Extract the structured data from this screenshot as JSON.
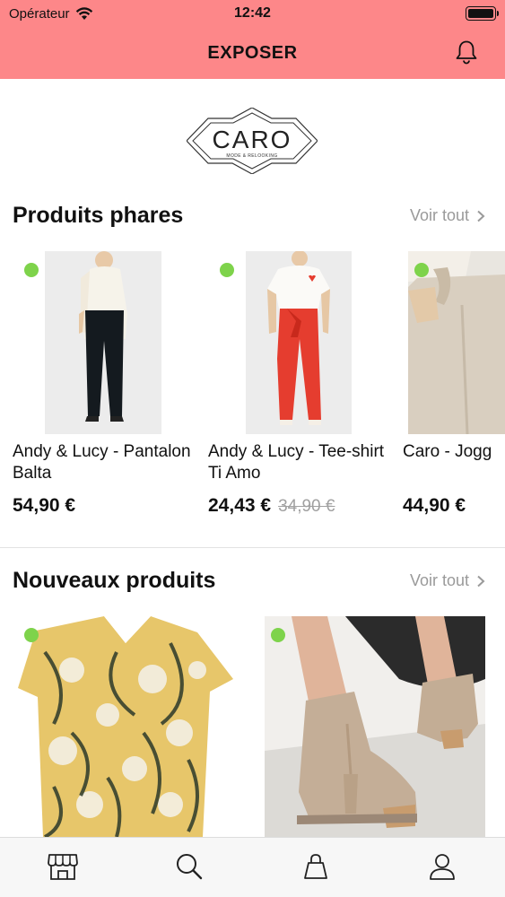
{
  "status_bar": {
    "carrier": "Opérateur",
    "time": "12:42",
    "icons": [
      "wifi-icon",
      "battery-icon"
    ]
  },
  "nav": {
    "title": "EXPOSER",
    "right_icon": "bell-icon"
  },
  "logo": {
    "brand": "CARO",
    "tagline": "MODE & RELOOKING"
  },
  "featured": {
    "title": "Produits phares",
    "see_all": "Voir tout",
    "products": [
      {
        "name": "Andy & Lucy - Pantalon Balta",
        "price": "54,90 €",
        "old_price": ""
      },
      {
        "name": "Andy & Lucy - Tee-shirt Ti Amo",
        "price": "24,43 €",
        "old_price": "34,90 €"
      },
      {
        "name": "Caro - Jogg",
        "price": "44,90 €",
        "old_price": ""
      }
    ]
  },
  "new_products": {
    "title": "Nouveaux produits",
    "see_all": "Voir tout"
  },
  "tab_bar": {
    "tabs": [
      "shop-icon",
      "search-icon",
      "bag-icon",
      "user-icon"
    ]
  },
  "colors": {
    "header": "#fd8789",
    "availability_dot": "#7ed34b",
    "muted_text": "#9a9a9a"
  }
}
